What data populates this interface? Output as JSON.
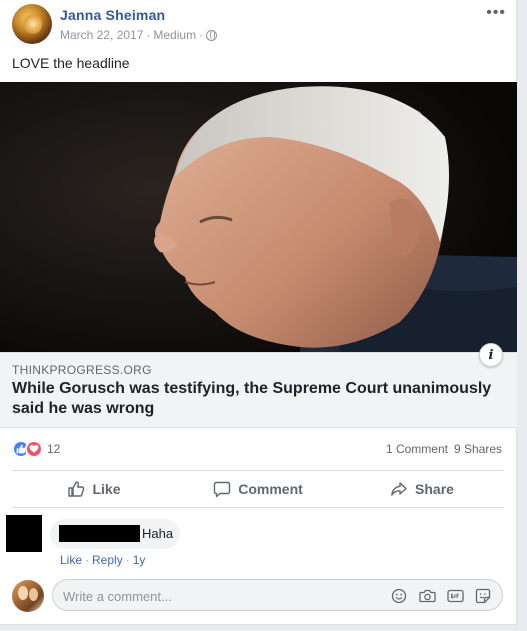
{
  "post": {
    "author": "Janna Sheiman",
    "date": "March 22, 2017",
    "sep1": "·",
    "source": "Medium",
    "sep2": "·",
    "more": "•••",
    "text": "LOVE the headline"
  },
  "link": {
    "domain": "THINKPROGRESS.ORG",
    "headline": "While Gorusch was testifying, the Supreme Court unanimously said he was wrong",
    "info": "i"
  },
  "stats": {
    "reaction_count": "12",
    "comments": "1 Comment",
    "shares": "9 Shares"
  },
  "actions": {
    "like": "Like",
    "comment": "Comment",
    "share": "Share"
  },
  "comment": {
    "text": "Haha",
    "like": "Like",
    "dot1": "·",
    "reply": "Reply",
    "dot2": "·",
    "time": "1y"
  },
  "write": {
    "placeholder": "Write a comment..."
  },
  "colors": {
    "author_link": "#365899",
    "like_reaction": "#4080ff",
    "love_reaction": "#f25268",
    "link_blue": "#4267b2"
  },
  "icons": [
    "more-icon",
    "globe-icon",
    "info-icon",
    "like-reaction-icon",
    "love-reaction-icon",
    "thumbs-up-icon",
    "comment-icon",
    "share-icon",
    "emoji-icon",
    "camera-icon",
    "gif-icon",
    "sticker-icon"
  ]
}
